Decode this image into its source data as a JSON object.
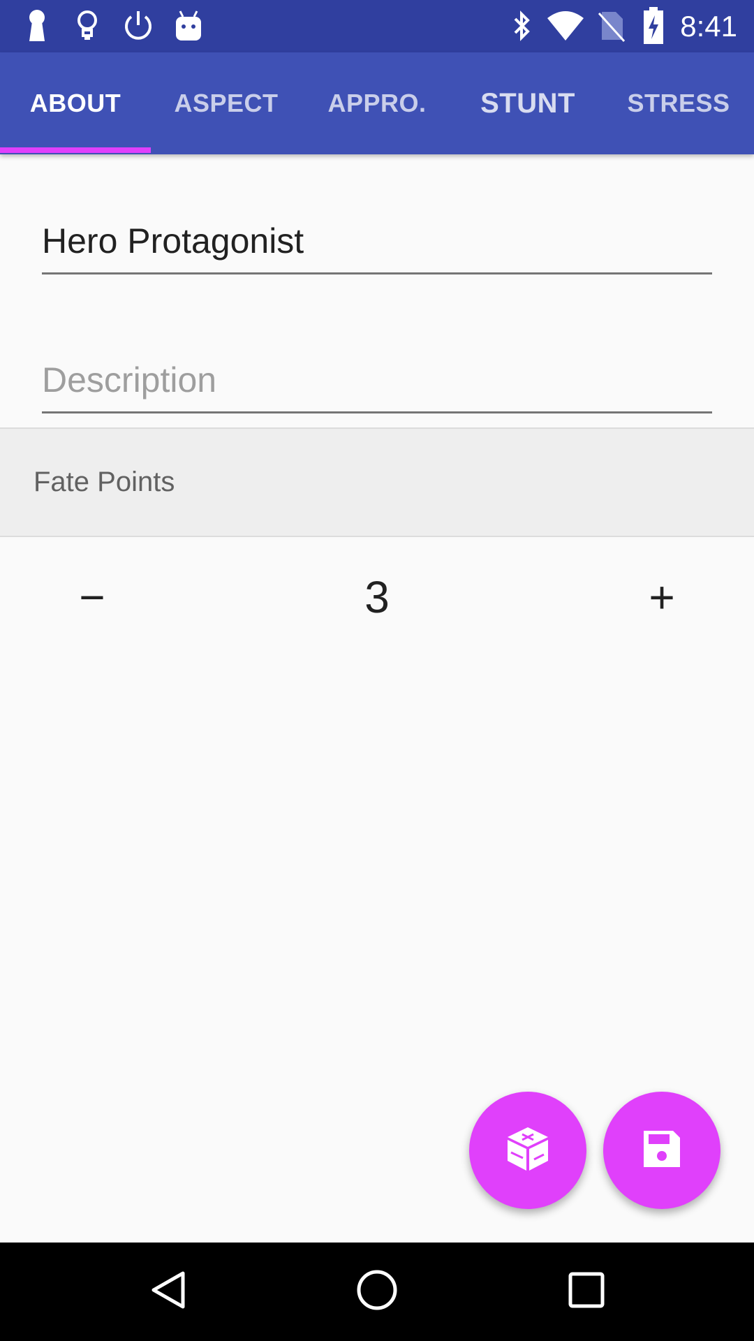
{
  "status_bar": {
    "time": "8:41",
    "left_icons": [
      "keyhole-icon",
      "lightbulb-icon",
      "power-icon",
      "android-icon"
    ],
    "right_icons": [
      "bluetooth-icon",
      "wifi-icon",
      "no-sim-icon",
      "battery-charging-icon"
    ]
  },
  "tabs": [
    {
      "label": "ABOUT",
      "active": true
    },
    {
      "label": "ASPECT",
      "active": false
    },
    {
      "label": "APPRO.",
      "active": false
    },
    {
      "label": "STUNT",
      "active": false
    },
    {
      "label": "STRESS",
      "active": false
    }
  ],
  "form": {
    "name_value": "Hero Protagonist",
    "description_placeholder": "Description"
  },
  "fate_points": {
    "header": "Fate Points",
    "decrement_label": "−",
    "value": "3",
    "increment_label": "+"
  },
  "fabs": [
    {
      "icon": "dice-icon"
    },
    {
      "icon": "save-icon"
    }
  ],
  "colors": {
    "status_bar": "#303f9f",
    "tab_bar": "#3f51b5",
    "accent": "#e040fb",
    "background": "#fafafa"
  }
}
